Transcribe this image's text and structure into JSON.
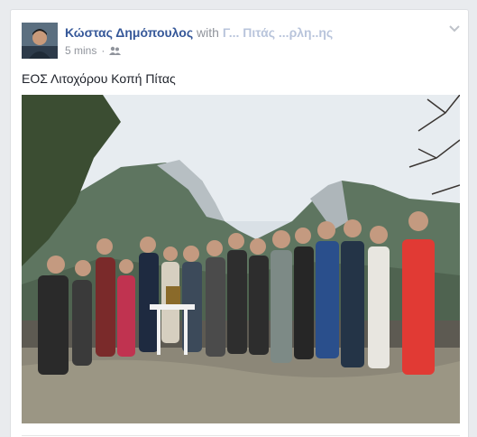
{
  "post": {
    "author_name": "Κώστας Δημόπουλος",
    "with_label": "with",
    "tagged_partial": "Γ... Πιτάς ...ρλη..ης",
    "timestamp": "5 mins",
    "audience_icon": "friends-icon",
    "menu_icon": "chevron-down-icon",
    "text": "ΕΟΣ Λιτοχόρου Κοπή Πίτας",
    "photo_icon": "group-photo"
  },
  "colors": {
    "link": "#365899",
    "meta": "#90949c",
    "text": "#1d2129",
    "page_bg": "#e9ebee"
  }
}
